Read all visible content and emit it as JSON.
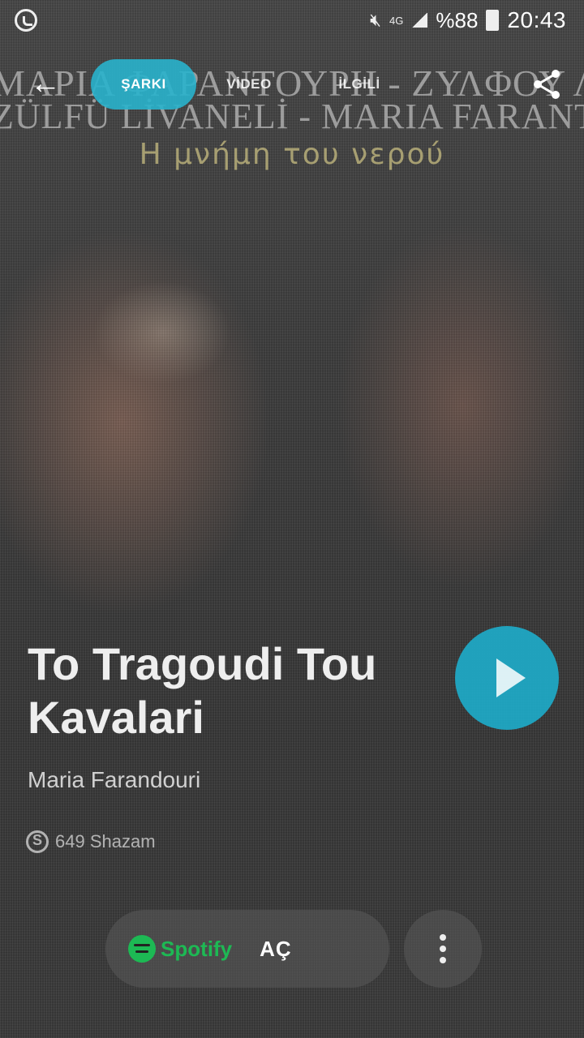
{
  "status_bar": {
    "network": "4G",
    "battery": "%88",
    "time": "20:43"
  },
  "poster": {
    "line1": "ΜΑΡΙΑ ΦΑΡΑΝΤΟΥΡΗ - ΖΥΛΦΟΥ ΛΙΒΑΝΕΛΗ",
    "line2": "ZÜLFÜ LİVANELİ - MARIA FARANTOURİ",
    "line3": "Η μνήμη του νερού"
  },
  "nav": {
    "tabs": [
      {
        "label": "ŞARKI"
      },
      {
        "label": "VİDEO"
      },
      {
        "label": "İLGİLİ"
      }
    ]
  },
  "song": {
    "title": "To Tragoudi Tou Kavalari",
    "artist": "Maria Farandouri",
    "shazam_count": "649 Shazam"
  },
  "actions": {
    "provider": "Spotify",
    "open_label": "AÇ"
  }
}
